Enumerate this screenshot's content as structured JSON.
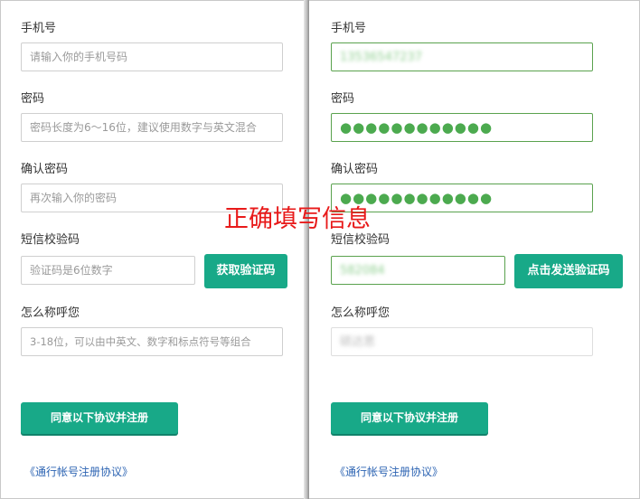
{
  "overlay_caption": "正确填写信息",
  "left_form": {
    "phone_label": "手机号",
    "phone_placeholder": "请输入你的手机号码",
    "password_label": "密码",
    "password_placeholder": "密码长度为6～16位，建议使用数字与英文混合",
    "confirm_label": "确认密码",
    "confirm_placeholder": "再次输入你的密码",
    "sms_label": "短信校验码",
    "sms_placeholder": "验证码是6位数字",
    "get_code_button": "获取验证码",
    "nickname_label": "怎么称呼您",
    "nickname_placeholder": "3-18位，可以由中英文、数字和标点符号等组合",
    "register_button": "同意以下协议并注册",
    "agreement_link": "《通行帐号注册协议》"
  },
  "right_form": {
    "phone_label": "手机号",
    "phone_value": "13536547237",
    "password_label": "密码",
    "password_value": "●●●●●●●●●●●●",
    "confirm_label": "确认密码",
    "confirm_value": "●●●●●●●●●●●●",
    "sms_label": "短信校验码",
    "sms_value": "582084",
    "send_code_button": "点击发送验证码",
    "nickname_label": "怎么称呼您",
    "nickname_value": "硕达思",
    "register_button": "同意以下协议并注册",
    "agreement_link": "《通行帐号注册协议》"
  },
  "colors": {
    "accent": "#18a988",
    "valid_border": "#5aa24e",
    "caption": "#e81a1a",
    "link": "#2d64b3"
  }
}
